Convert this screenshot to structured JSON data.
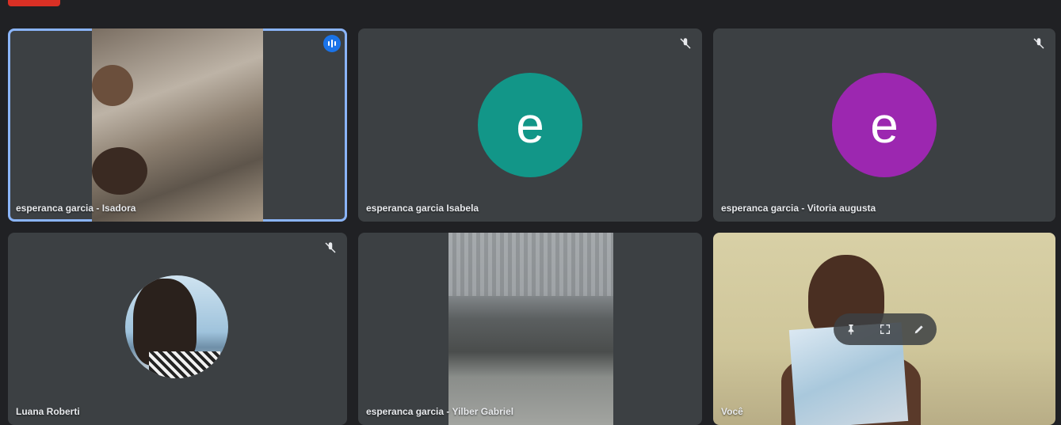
{
  "tiles": [
    {
      "name": "esperanca garcia - Isadora",
      "type": "video",
      "speaking": true
    },
    {
      "name": "esperanca garcia Isabela",
      "type": "avatar",
      "initial": "e",
      "avatar_color": "#129688"
    },
    {
      "name": "esperanca garcia - Vitoria augusta",
      "type": "avatar",
      "initial": "e",
      "avatar_color": "#9c27b0"
    },
    {
      "name": "Luana Roberti",
      "type": "profile-photo"
    },
    {
      "name": "esperanca garcia - Yilber Gabriel",
      "type": "video"
    },
    {
      "name": "Você",
      "type": "video-self"
    }
  ],
  "colors": {
    "accent": "#8ab4f8",
    "recording": "#d93025",
    "tile_bg": "#3c4043",
    "page_bg": "#202124"
  },
  "icons": {
    "muted": "mic-off-icon",
    "speaking": "audio-level-icon",
    "pin": "pin-icon",
    "fullscreen": "fullscreen-icon",
    "more": "more-options-icon"
  }
}
